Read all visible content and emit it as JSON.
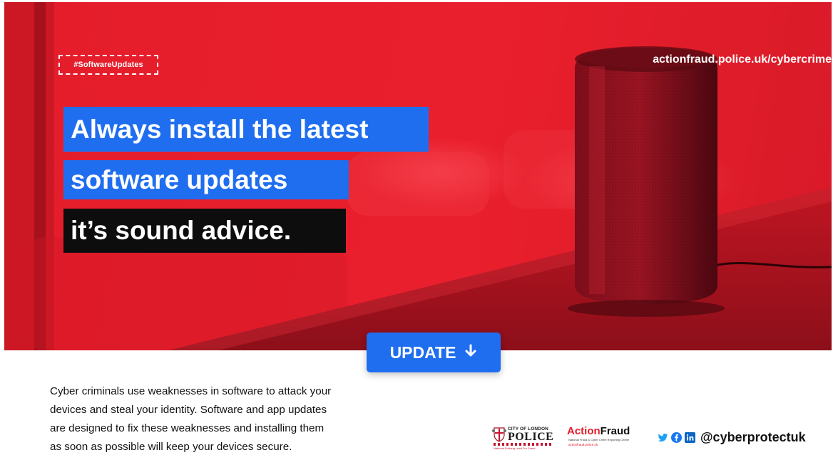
{
  "hero": {
    "hashtag": "#SoftwareUpdates",
    "site_url": "actionfraud.police.uk/cybercrime",
    "headline": [
      "Always install the latest",
      "software updates",
      "it’s sound advice."
    ]
  },
  "update_button": {
    "label": "UPDATE",
    "icon": "arrow-down-icon"
  },
  "body_copy": {
    "lines": [
      "Cyber criminals use weaknesses in software to attack your",
      "devices and steal your identity. Software and app updates",
      "are designed to fix these weaknesses and installing them",
      "as soon as possible will keep your devices secure."
    ]
  },
  "footer": {
    "police_logo": {
      "city_text": "CITY OF LONDON",
      "police_text": "POLICE",
      "tagline": "National Policing Lead For Fraud"
    },
    "action_fraud_logo": {
      "action": "Action",
      "fraud": "Fraud",
      "subtitle": "National Fraud & Cyber Crime Reporting Centre",
      "url": "actionfraud.police.uk"
    },
    "social": {
      "icons": [
        "twitter-icon",
        "facebook-icon",
        "linkedin-icon"
      ],
      "handle": "@cyberprotectuk"
    }
  },
  "colors": {
    "hero_red": "#e41d2b",
    "accent_blue": "#1f6ef0",
    "black_band": "#0d0d0d",
    "twitter": "#1da1f2",
    "facebook": "#1877f2",
    "linkedin": "#0a66c2"
  }
}
